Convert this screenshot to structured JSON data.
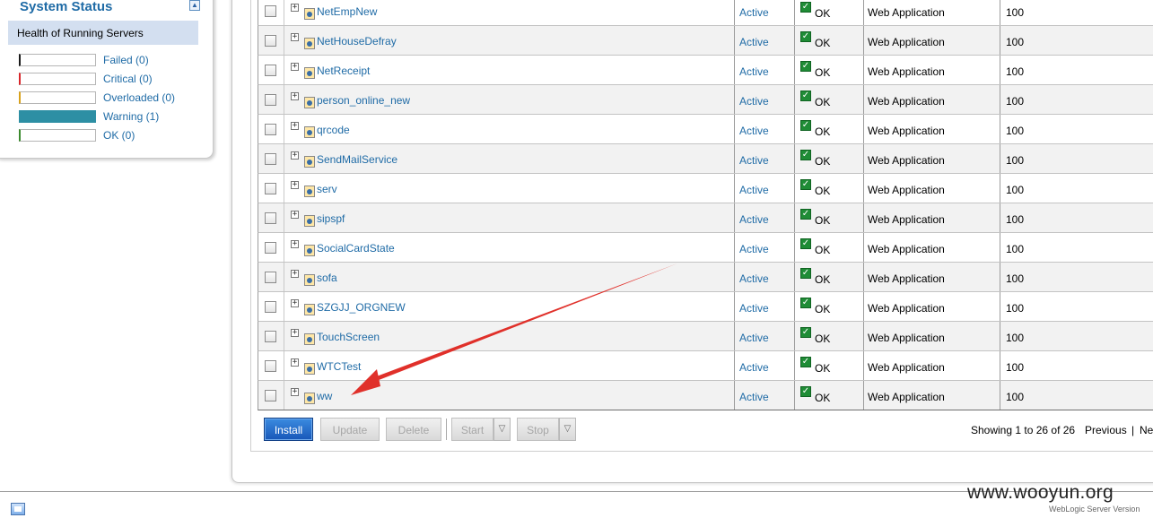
{
  "system_status": {
    "title": "System Status",
    "health_heading": "Health of Running Servers",
    "legend": [
      {
        "label": "Failed (0)",
        "color": "#1a1a1a",
        "level": 0
      },
      {
        "label": "Critical (0)",
        "color": "#d9262a",
        "level": 0
      },
      {
        "label": "Overloaded (0)",
        "color": "#d9a21b",
        "level": 0
      },
      {
        "label": "Warning (1)",
        "color": "#2d8fa4",
        "level": 1
      },
      {
        "label": "OK (0)",
        "color": "#3b8a2e",
        "level": 0
      }
    ]
  },
  "deployments": {
    "rows": [
      {
        "name": "NetEmpNew",
        "state": "Active",
        "health": "OK",
        "type": "Web Application",
        "order": "100"
      },
      {
        "name": "NetHouseDefray",
        "state": "Active",
        "health": "OK",
        "type": "Web Application",
        "order": "100"
      },
      {
        "name": "NetReceipt",
        "state": "Active",
        "health": "OK",
        "type": "Web Application",
        "order": "100"
      },
      {
        "name": "person_online_new",
        "state": "Active",
        "health": "OK",
        "type": "Web Application",
        "order": "100"
      },
      {
        "name": "qrcode",
        "state": "Active",
        "health": "OK",
        "type": "Web Application",
        "order": "100"
      },
      {
        "name": "SendMailService",
        "state": "Active",
        "health": "OK",
        "type": "Web Application",
        "order": "100"
      },
      {
        "name": "serv",
        "state": "Active",
        "health": "OK",
        "type": "Web Application",
        "order": "100"
      },
      {
        "name": "sipspf",
        "state": "Active",
        "health": "OK",
        "type": "Web Application",
        "order": "100"
      },
      {
        "name": "SocialCardState",
        "state": "Active",
        "health": "OK",
        "type": "Web Application",
        "order": "100"
      },
      {
        "name": "sofa",
        "state": "Active",
        "health": "OK",
        "type": "Web Application",
        "order": "100"
      },
      {
        "name": "SZGJJ_ORGNEW",
        "state": "Active",
        "health": "OK",
        "type": "Web Application",
        "order": "100"
      },
      {
        "name": "TouchScreen",
        "state": "Active",
        "health": "OK",
        "type": "Web Application",
        "order": "100"
      },
      {
        "name": "WTCTest",
        "state": "Active",
        "health": "OK",
        "type": "Web Application",
        "order": "100"
      },
      {
        "name": "ww",
        "state": "Active",
        "health": "OK",
        "type": "Web Application",
        "order": "100"
      }
    ]
  },
  "toolbar": {
    "install": "Install",
    "update": "Update",
    "delete": "Delete",
    "start": "Start",
    "stop": "Stop"
  },
  "pagination": {
    "showing": "Showing 1 to 26 of 26",
    "previous": "Previous",
    "separator": "|",
    "next": "Ne"
  },
  "footer": {
    "watermark": "www.wooyun.org",
    "version": "WebLogic Server Version"
  },
  "colors": {
    "link": "#1f6ba6",
    "primary_button": "#1f6ad0",
    "annotation_arrow": "#e0302a"
  }
}
